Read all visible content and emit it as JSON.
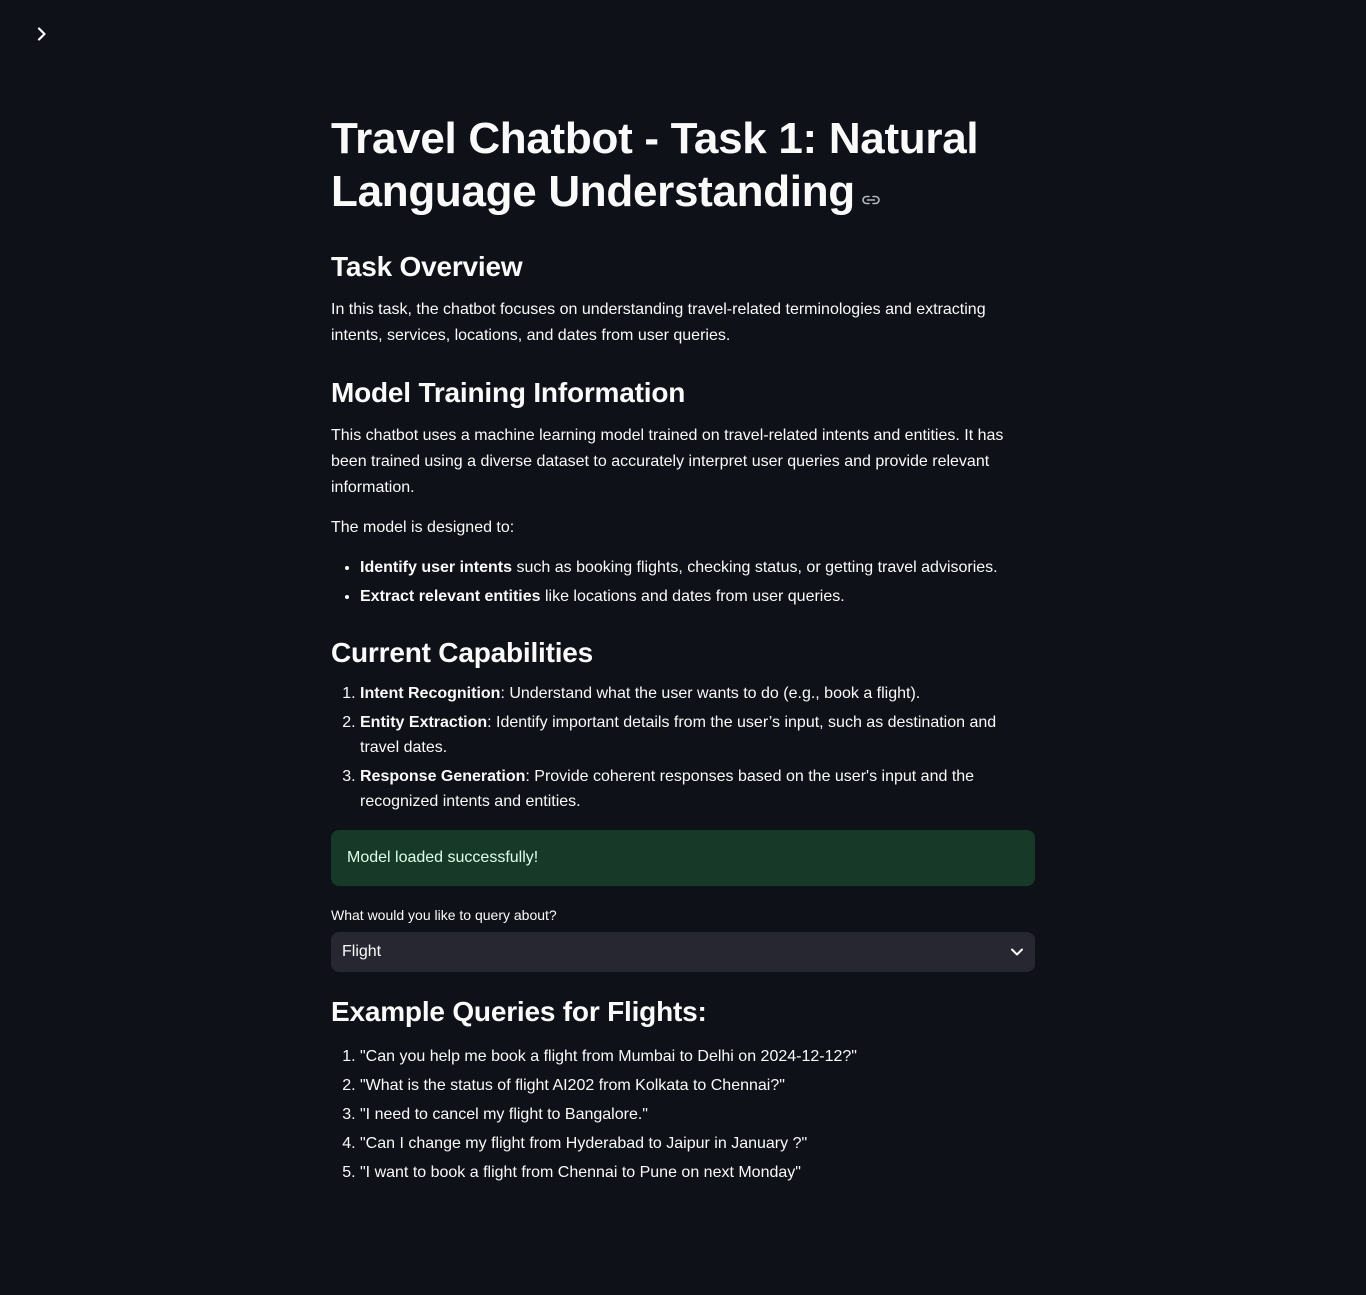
{
  "sidebar": {
    "toggle_icon": "chevron-right-icon"
  },
  "main": {
    "title": "Travel Chatbot - Task 1: Natural Language Understanding",
    "title_link_icon": "link-icon",
    "overview": {
      "heading": "Task Overview",
      "text": "In this task, the chatbot focuses on understanding travel-related terminologies and extracting intents, services, locations, and dates from user queries."
    },
    "model_info": {
      "heading": "Model Training Information",
      "text": "This chatbot uses a machine learning model trained on travel-related intents and entities. It has been trained using a diverse dataset to accurately interpret user queries and provide relevant information.",
      "designed_to": "The model is designed to:",
      "bullets": [
        {
          "bold": "Identify user intents",
          "rest": " such as booking flights, checking status, or getting travel advisories."
        },
        {
          "bold": "Extract relevant entities",
          "rest": " like locations and dates from user queries."
        }
      ]
    },
    "capabilities": {
      "heading": "Current Capabilities",
      "items": [
        {
          "bold": "Intent Recognition",
          "rest": ": Understand what the user wants to do (e.g., book a flight)."
        },
        {
          "bold": "Entity Extraction",
          "rest": ": Identify important details from the user’s input, such as destination and travel dates."
        },
        {
          "bold": "Response Generation",
          "rest": ": Provide coherent responses based on the user's input and the recognized intents and entities."
        }
      ]
    },
    "status": {
      "text": "Model loaded successfully!",
      "color": "#173928"
    },
    "query_select": {
      "label": "What would you like to query about?",
      "value": "Flight",
      "icon": "chevron-down-icon"
    },
    "examples": {
      "heading": "Example Queries for Flights:",
      "items": [
        "\"Can you help me book a flight from Mumbai to Delhi on 2024-12-12?\"",
        "\"What is the status of flight AI202 from Kolkata to Chennai?\"",
        "\"I need to cancel my flight to Bangalore.\"",
        "\"Can I change my flight from Hyderabad to Jaipur in January ?\"",
        "\"I want to book a flight from Chennai to Pune on next Monday\""
      ]
    }
  }
}
